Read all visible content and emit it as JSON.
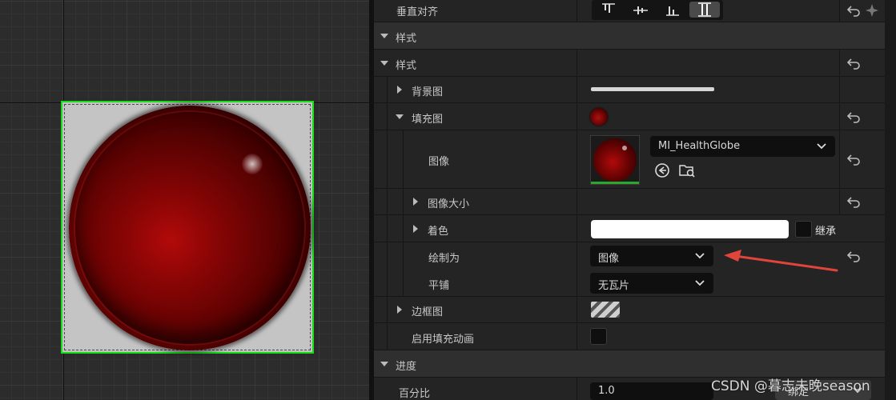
{
  "viewport": {
    "image_name": "MI_HealthGlobe"
  },
  "details": {
    "rows": {
      "vertical_align": {
        "label": "垂直对齐"
      },
      "style_category": {
        "label": "样式"
      },
      "style": {
        "label": "样式"
      },
      "background_image": {
        "label": "背景图"
      },
      "fill_image": {
        "label": "填充图"
      },
      "image": {
        "label": "图像",
        "asset": "MI_HealthGlobe"
      },
      "image_size": {
        "label": "图像大小"
      },
      "tint": {
        "label": "着色",
        "inherit_label": "继承",
        "color": "#ffffff"
      },
      "draw_as": {
        "label": "绘制为",
        "value": "图像"
      },
      "tiling": {
        "label": "平铺",
        "value": "无瓦片"
      },
      "border_image": {
        "label": "边框图"
      },
      "enable_fill_animation": {
        "label": "启用填充动画"
      },
      "progress_category": {
        "label": "进度"
      },
      "percent": {
        "label": "百分比",
        "value": "1.0",
        "bind_label": "绑定"
      }
    }
  },
  "colors": {
    "selection_outline": "#18e018",
    "arrow_annotation": "#e0443a",
    "globe_red": "#8a0505"
  },
  "watermark": "CSDN @暮志未晚season"
}
